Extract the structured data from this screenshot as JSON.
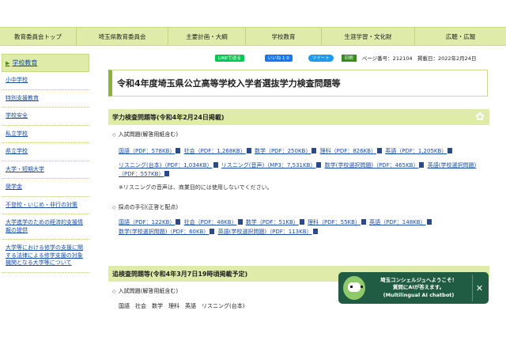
{
  "topnav": [
    "教育委員会トップ",
    "埼玉県教育委員会",
    "主要計画・大綱",
    "学校教育",
    "生涯学習・文化財",
    "広聴・広報"
  ],
  "sidebar": {
    "head": "学校教育",
    "items": [
      "小中学校",
      "特別支援教育",
      "学校安全",
      "私立学校",
      "県立学校",
      "大学・短期大学",
      "奨学金",
      "不登校・いじめ・非行の対策",
      "大学進学のための経済的支援情報の提供",
      "大学等における修学の支援に関する法律による修学支援の対象機関となる大学等について"
    ]
  },
  "share": {
    "line": "LINEで送る",
    "fb": "いいね 1 0",
    "tw": "ツイート",
    "print": "印刷",
    "meta": "ページ番号：212104　掲載日：2022年2月24日"
  },
  "title": "令和4年度埼玉県公立高等学校入学者選抜学力検査問題等",
  "sec1": {
    "heading": "学力検査問題等(令和4年2月24日掲載)",
    "b1": "入試問題(解答用紙含む)",
    "row1": [
      "国語（PDF：578KB）",
      "社会（PDF：1,268KB）",
      "数学（PDF：250KB）",
      "理科（PDF：826KB）",
      "英語（PDF：1,205KB）"
    ],
    "row2": [
      "リスニング(台本)（PDF：1,034KB）",
      "リスニング(音声)（MP3：7,531KB）",
      "数学(学校選択問題)（PDF：465KB）",
      "英語(学校選択問題)（PDF：557KB）"
    ],
    "note": "※リスニングの音声は、商業目的には使用しないでください。",
    "b2": "採点の手引(正答と配点)",
    "row3": [
      "国語（PDF：122KB）",
      "社会（PDF：48KB）",
      "数学（PDF：51KB）",
      "理科（PDF：55KB）",
      "英語（PDF：148KB）"
    ],
    "row4": [
      "数学(学校選択問題)（PDF：60KB）",
      "英語(学校選択問題)（PDF：113KB）"
    ]
  },
  "sec2": {
    "heading": "追検査問題等(令和4年3月7日19時頃掲載予定)",
    "b1": "入試問題(解答用紙含む)",
    "row1": "国語　社会　数学　理科　英語　リスニング(台本)"
  },
  "chatbot": {
    "line1": "埼玉コンシェルジュへようこそ！",
    "line2": "質問にAIが答えます。",
    "line3": "(Multilingual AI chatbot)",
    "close": "✕"
  }
}
